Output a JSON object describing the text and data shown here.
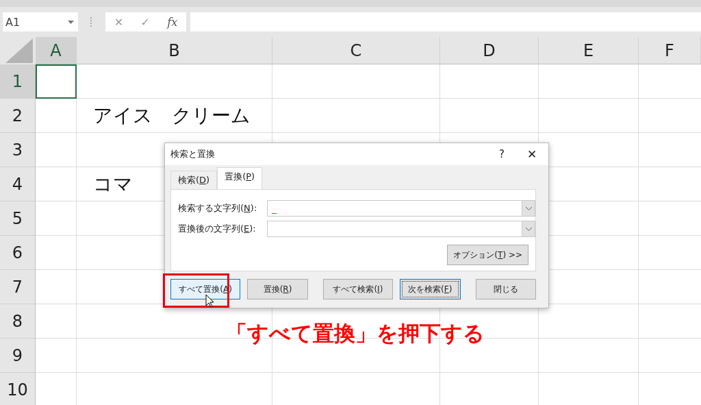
{
  "name_box": {
    "value": "A1"
  },
  "formula_bar": {
    "cancel": "✕",
    "enter": "✓",
    "fx": "fx"
  },
  "columns": [
    {
      "label": "A",
      "selected": true
    },
    {
      "label": "B",
      "selected": false
    },
    {
      "label": "C",
      "selected": false
    },
    {
      "label": "D",
      "selected": false
    },
    {
      "label": "E",
      "selected": false
    },
    {
      "label": "F",
      "selected": false
    }
  ],
  "rows": [
    {
      "label": "1",
      "selected": true,
      "cells": {}
    },
    {
      "label": "2",
      "selected": false,
      "cells": {
        "B": "アイス　クリーム"
      }
    },
    {
      "label": "3",
      "selected": false,
      "cells": {}
    },
    {
      "label": "4",
      "selected": false,
      "cells": {
        "B": "コマ"
      }
    },
    {
      "label": "5",
      "selected": false,
      "cells": {}
    },
    {
      "label": "6",
      "selected": false,
      "cells": {}
    },
    {
      "label": "7",
      "selected": false,
      "cells": {}
    },
    {
      "label": "8",
      "selected": false,
      "cells": {}
    },
    {
      "label": "9",
      "selected": false,
      "cells": {}
    },
    {
      "label": "10",
      "selected": false,
      "cells": {}
    }
  ],
  "dialog": {
    "title": "検索と置換",
    "help": "?",
    "close": "✕",
    "tabs": [
      {
        "label": [
          "検索(",
          "D",
          ")"
        ],
        "selected": false
      },
      {
        "label": [
          "置換(",
          "P",
          ")"
        ],
        "selected": true
      }
    ],
    "fields": [
      {
        "label": [
          "検索する文字列(",
          "N",
          "):"
        ],
        "value": "_"
      },
      {
        "label": [
          "置換後の文字列(",
          "E",
          "):"
        ]
      }
    ],
    "options_button": [
      "オプション(",
      "T",
      ") >>"
    ],
    "buttons": [
      {
        "label": [
          "すべて置換(",
          "A",
          ")"
        ],
        "highlighted": true,
        "default": false
      },
      {
        "label": [
          "置換(",
          "R",
          ")"
        ],
        "highlighted": false,
        "default": false
      },
      {
        "label": [
          "すべて検索(",
          "I",
          ")"
        ],
        "highlighted": false,
        "default": false
      },
      {
        "label": [
          "次を検索(",
          "F",
          ")"
        ],
        "highlighted": false,
        "default": true
      },
      {
        "label": [
          "閉じる"
        ],
        "highlighted": false,
        "default": false
      }
    ]
  },
  "annotation": "「すべて置換」を押下する"
}
